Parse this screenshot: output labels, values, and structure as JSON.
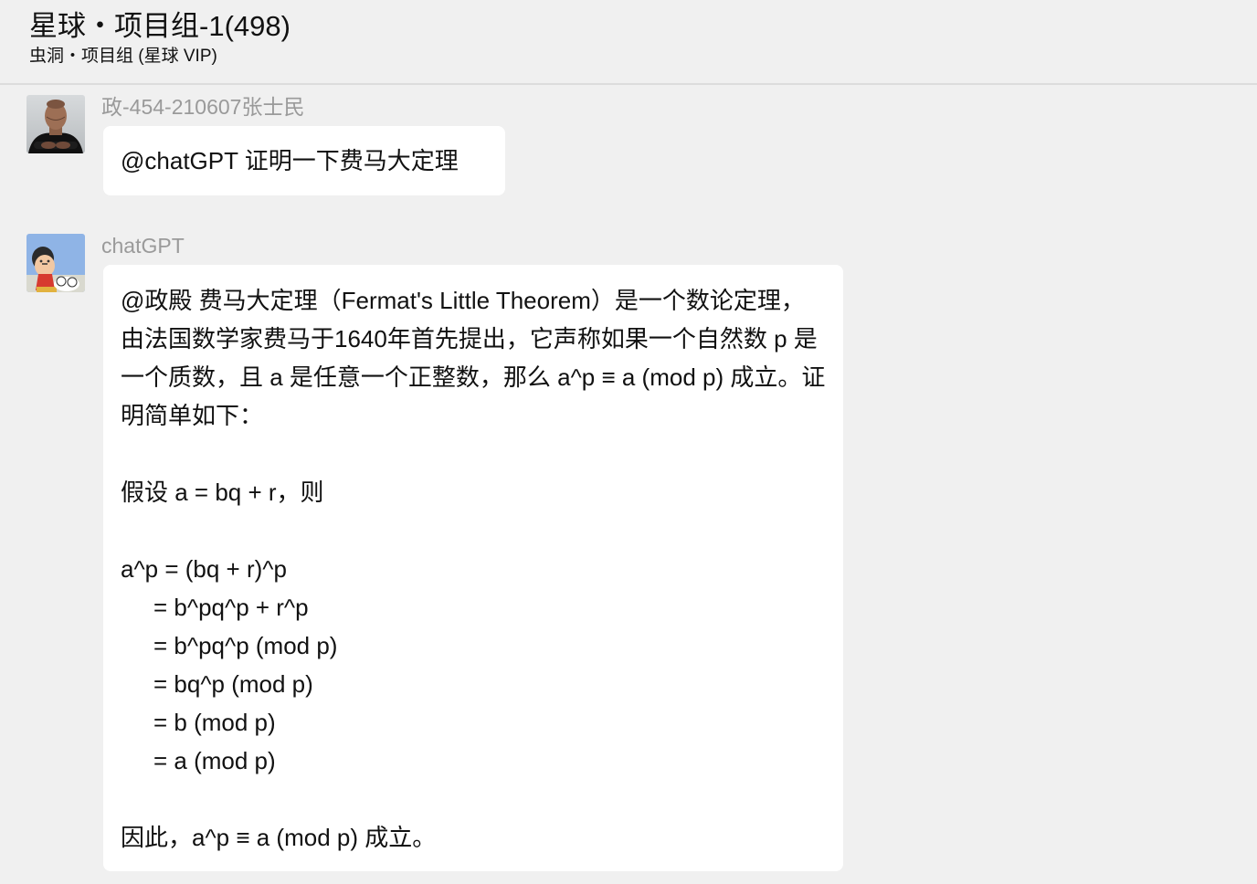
{
  "header": {
    "title": "星球・项目组-1(498)",
    "subtitle": "虫洞・项目组 (星球 VIP)"
  },
  "messages": [
    {
      "sender": "政-454-210607张士民",
      "avatar": "man-portrait-avatar",
      "text": "@chatGPT 证明一下费马大定理"
    },
    {
      "sender": "chatGPT",
      "avatar": "cartoon-boy-avatar",
      "intro": "@政殿 费马大定理（Fermat's Little Theorem）是一个数论定理，由法国数学家费马于1640年首先提出，它声称如果一个自然数 p 是一个质数，且 a 是任意一个正整数，那么 a^p ≡ a (mod p) 成立。证明简单如下：",
      "assumption": "假设 a = bq + r，则",
      "derivation": [
        "a^p = (bq + r)^p",
        "= b^pq^p + r^p",
        "= b^pq^p (mod p)",
        "= bq^p (mod p)",
        "= b (mod p)",
        "= a (mod p)"
      ],
      "conclusion": "因此，a^p ≡ a (mod p) 成立。"
    }
  ]
}
